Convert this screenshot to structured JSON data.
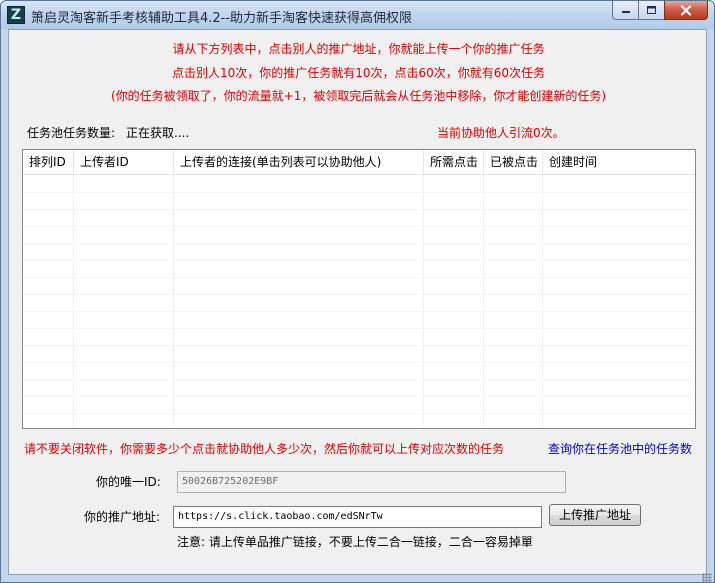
{
  "window": {
    "title": "箫启灵淘客新手考核辅助工具4.2--助力新手淘客快速获得高佣权限",
    "icon_letter": "Z"
  },
  "notices": {
    "line1": "请从下方列表中，点击别人的推广地址，你就能上传一个你的推广任务",
    "line2": "点击别人10次，你的推广任务就有10次，点击60次，你就有60次任务",
    "line3": "(你的任务被领取了，你的流量就+1，被领取完后就会从任务池中移除，你才能创建新的任务)"
  },
  "task_pool": {
    "count_label": "任务池任务数量:",
    "count_value": "正在获取....",
    "assist_text": "当前协助他人引流0次。"
  },
  "table": {
    "columns": [
      {
        "label": "排列ID"
      },
      {
        "label": "上传者ID"
      },
      {
        "label": "上传者的连接(单击列表可以协助他人)"
      },
      {
        "label": "所需点击"
      },
      {
        "label": "已被点击"
      },
      {
        "label": "创建时间"
      }
    ],
    "rows": []
  },
  "warning_text": "请不要关闭软件，你需要多少个点击就协助他人多少次，然后你就可以上传对应次数的任务",
  "query_link": "查询你在任务池中的任务数",
  "form": {
    "id_label": "你的唯一ID:",
    "id_value": "50026B725202E9BF",
    "url_label": "你的推广地址:",
    "url_value": "https://s.click.taobao.com/edSNrTw",
    "upload_button": "上传推广地址",
    "note": "注意: 请上传单品推广链接，不要上传二合一链接，二合一容易掉單"
  }
}
